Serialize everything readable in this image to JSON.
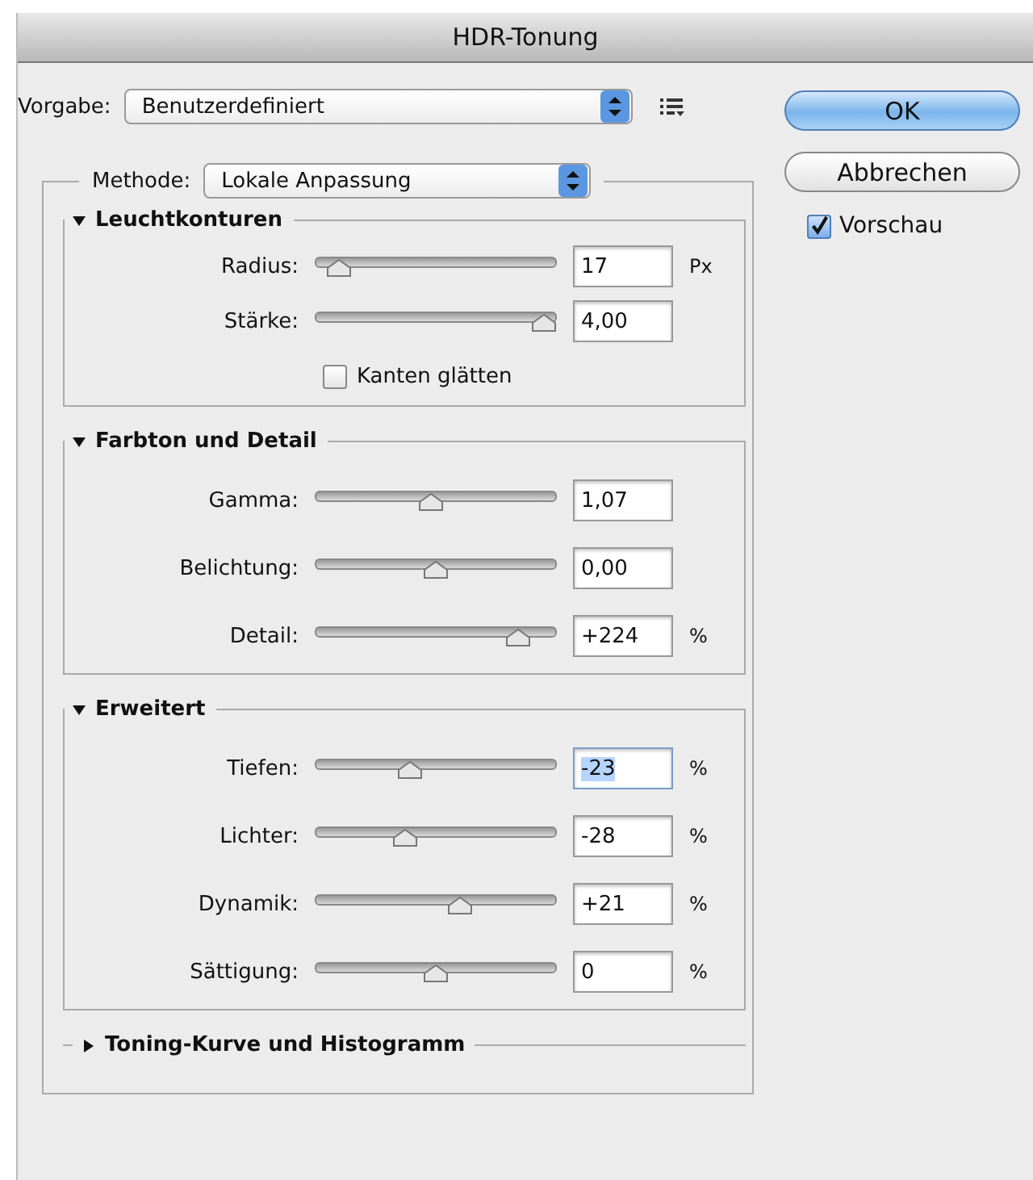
{
  "window": {
    "title": "HDR-Tonung"
  },
  "preset": {
    "label": "Vorgabe:",
    "value": "Benutzerdefiniert"
  },
  "method": {
    "label": "Methode:",
    "value": "Lokale Anpassung"
  },
  "sections": [
    {
      "title": "Leuchtkonturen",
      "expanded": true,
      "rows": [
        {
          "kind": "slider",
          "label": "Radius:",
          "level": 0.05,
          "value": "17",
          "unit": "Px",
          "text_selected": false
        },
        {
          "kind": "slider",
          "label": "Stärke:",
          "level": 1.0,
          "value": "4,00",
          "text_selected": false
        },
        {
          "kind": "checkbox",
          "label": "Kanten glätten",
          "checked": false
        }
      ]
    },
    {
      "title": "Farbton und Detail",
      "expanded": true,
      "rows": [
        {
          "kind": "slider",
          "label": "Gamma:",
          "level": 0.48,
          "value": "1,07",
          "text_selected": false
        },
        {
          "kind": "slider",
          "label": "Belichtung:",
          "level": 0.5,
          "value": "0,00",
          "text_selected": false
        },
        {
          "kind": "slider",
          "label": "Detail:",
          "level": 0.88,
          "value": "+224",
          "unit": "%",
          "text_selected": false
        }
      ]
    },
    {
      "title": "Erweitert",
      "expanded": true,
      "rows": [
        {
          "kind": "slider",
          "label": "Tiefen:",
          "level": 0.38,
          "value": "-23",
          "unit": "%",
          "text_selected": true
        },
        {
          "kind": "slider",
          "label": "Lichter:",
          "level": 0.36,
          "value": "-28",
          "unit": "%",
          "text_selected": false
        },
        {
          "kind": "slider",
          "label": "Dynamik:",
          "level": 0.61,
          "value": "+21",
          "unit": "%",
          "text_selected": false
        },
        {
          "kind": "slider",
          "label": "Sättigung:",
          "level": 0.5,
          "value": "0",
          "unit": "%",
          "text_selected": false
        }
      ]
    },
    {
      "title": "Toning-Kurve und Histogramm",
      "expanded": false
    }
  ],
  "buttons": [
    {
      "label": "OK",
      "default": true
    },
    {
      "label": "Abbrechen",
      "default": false
    }
  ],
  "preview": {
    "label": "Vorschau",
    "checked": true
  }
}
